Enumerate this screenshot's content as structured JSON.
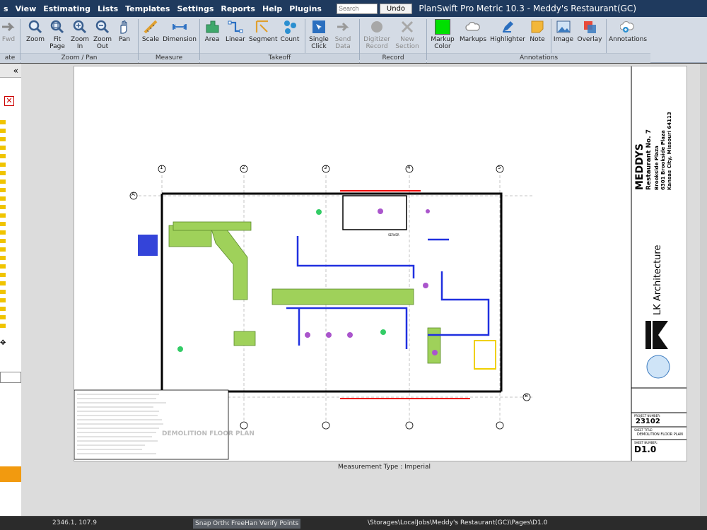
{
  "app": {
    "title": "PlanSwift Pro Metric 10.3 - Meddy's Restaurant(GC)"
  },
  "menu": {
    "items": [
      "s",
      "View",
      "Estimating",
      "Lists",
      "Templates",
      "Settings",
      "Reports",
      "Help",
      "Plugins"
    ],
    "search_placeholder": "Search",
    "undo_label": "Undo"
  },
  "ribbon": {
    "buttons": {
      "fwd": "Fwd",
      "zoom": "Zoom",
      "fit_page_1": "Fit",
      "fit_page_2": "Page",
      "zoom_in_1": "Zoom",
      "zoom_in_2": "In",
      "zoom_out_1": "Zoom",
      "zoom_out_2": "Out",
      "pan": "Pan",
      "scale": "Scale",
      "dimension": "Dimension",
      "area": "Area",
      "linear": "Linear",
      "segment": "Segment",
      "count": "Count",
      "single_click_1": "Single",
      "single_click_2": "Click",
      "send_data_1": "Send",
      "send_data_2": "Data",
      "digitizer_record_1": "Digitizer",
      "digitizer_record_2": "Record",
      "new_section_1": "New",
      "new_section_2": "Section",
      "markup_color_1": "Markup",
      "markup_color_2": "Color",
      "markups": "Markups",
      "highlighter": "Highlighter",
      "note": "Note",
      "image": "Image",
      "overlay": "Overlay",
      "annotations": "Annotations"
    },
    "groups": {
      "left": "ate",
      "zoom_pan": "Zoom / Pan",
      "measure": "Measure",
      "takeoff": "Takeoff",
      "record": "Record",
      "annotations": "Annotations"
    },
    "colors": {
      "markup": "#00e000",
      "accent": "#1f3a5e"
    }
  },
  "drawing": {
    "plan_title": "DEMOLITION FLOOR PLAN",
    "firm": "LK Architecture",
    "project_name_1": "MEDDYS",
    "project_name_2": "Restaurant No. 7",
    "project_address_1": "Brookside Plaza",
    "project_address_2": "6301 Brookside Plaza",
    "project_address_3": "Kansas City, Missouri 64113",
    "project_number_label": "PROJECT NUMBER:",
    "project_number": "23102",
    "sheet_title_label": "SHEET TITLE:",
    "sheet_title": "DEMOLITION FLOOR PLAN",
    "sheet_number_label": "SHEET NUMBER:",
    "sheet_number": "D1.0",
    "grid_labels": [
      "1",
      "2",
      "3",
      "4",
      "5",
      "A",
      "B"
    ],
    "section_label": "SERVER"
  },
  "measurement_type": "Measurement Type : Imperial",
  "status": {
    "coords": "2346.1, 107.9",
    "snap": "Snap",
    "ortho": "Ortho",
    "freehand": "FreeHand",
    "verify_points": "Verify Points",
    "path": "\\Storages\\LocalJobs\\Meddy's Restaurant(GC)\\Pages\\D1.0"
  }
}
